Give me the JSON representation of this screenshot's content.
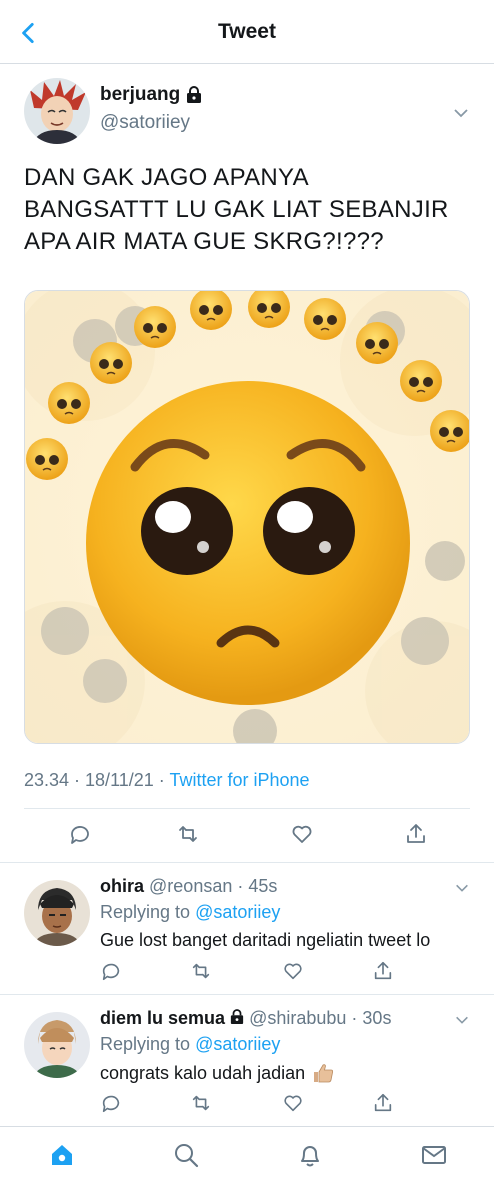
{
  "header": {
    "title": "Tweet"
  },
  "tweet": {
    "name": "berjuang",
    "handle": "@satoriiey",
    "text_lines": [
      "DAN GAK JAGO APANYA",
      "BANGSATTT LU GAK LIAT SEBANJIR",
      "APA AIR MATA GUE SKRG?!???"
    ],
    "time": "23.34 · 18/11/21 · ",
    "source": "Twitter for iPhone"
  },
  "replies": [
    {
      "name": "ohira",
      "handle": "@reonsan",
      "sep": " · ",
      "age": "45s",
      "replying_prefix": "Replying to ",
      "replying_to": "@satoriiey",
      "text": "Gue lost banget daritadi ngeliatin tweet lo"
    },
    {
      "name": "diem lu semua",
      "handle": "@shirabubu",
      "sep": " · ",
      "age": "30s",
      "replying_prefix": "Replying to ",
      "replying_to": "@satoriiey",
      "text": "congrats kalo udah jadian"
    }
  ],
  "colors": {
    "accent": "#1da1f2",
    "muted": "#657786",
    "emoji_face": "#f6b21f"
  }
}
